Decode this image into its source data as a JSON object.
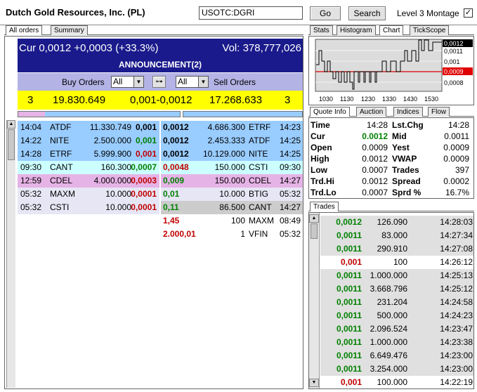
{
  "header": {
    "title": "Dutch Gold Resources, Inc. (PL)",
    "symbol": "USOTC:DGRI",
    "go_label": "Go",
    "search_label": "Search",
    "montage_label": "Level 3 Montage",
    "montage_checked": true
  },
  "left_tabs": [
    "All orders",
    "Summary"
  ],
  "banner": {
    "cur": "Cur 0,0012 +0,0003 (+33.3%)",
    "vol": "Vol: 378,777,026",
    "announcement": "ANNOUNCEMENT(2)",
    "bg": "#1a1a8c"
  },
  "filters": {
    "buy_label": "Buy Orders",
    "buy_value": "All",
    "sell_label": "Sell Orders",
    "sell_value": "All"
  },
  "summary": {
    "buy_count": "3",
    "buy_size": "19.830.649",
    "spread": "0,001-0,0012",
    "sell_size": "17.268.633",
    "sell_count": "3"
  },
  "buy_orders": [
    {
      "time": "14:04",
      "mm": "ATDF",
      "size": "11.330.749",
      "price": "0,001",
      "bg": "#99ccff",
      "color": "#000"
    },
    {
      "time": "14:22",
      "mm": "NITE",
      "size": "2.500.000",
      "price": "0,001",
      "bg": "#99ccff",
      "color": "#008000"
    },
    {
      "time": "14:28",
      "mm": "ETRF",
      "size": "5.999.900",
      "price": "0,001",
      "bg": "#99ccff",
      "color": "#c00000"
    },
    {
      "time": "09:30",
      "mm": "CANT",
      "size": "160.300",
      "price": "0,0007",
      "bg": "#ccffff",
      "color": "#008000"
    },
    {
      "time": "12:59",
      "mm": "CDEL",
      "size": "4.000.000",
      "price": "0,0003",
      "bg": "#e6b3e6",
      "color": "#c00000"
    },
    {
      "time": "05:32",
      "mm": "MAXM",
      "size": "10.000",
      "price": "0,0001",
      "bg": "#e6e6f5",
      "color": "#c00000"
    },
    {
      "time": "05:32",
      "mm": "CSTI",
      "size": "10.000",
      "price": "0,0001",
      "bg": "#e6e6f5",
      "color": "#c00000"
    }
  ],
  "sell_orders": [
    {
      "price": "0,0012",
      "size": "4.686.300",
      "mm": "ETRF",
      "time": "14:23",
      "bg": "#99ccff",
      "color": "#000"
    },
    {
      "price": "0,0012",
      "size": "2.453.333",
      "mm": "ATDF",
      "time": "14:25",
      "bg": "#99ccff",
      "color": "#000"
    },
    {
      "price": "0,0012",
      "size": "10.129.000",
      "mm": "NITE",
      "time": "14:25",
      "bg": "#99ccff",
      "color": "#000"
    },
    {
      "price": "0,0048",
      "size": "150.000",
      "mm": "CSTI",
      "time": "09:30",
      "bg": "#ccffff",
      "color": "#c00000"
    },
    {
      "price": "0,009",
      "size": "150.000",
      "mm": "CDEL",
      "time": "14:27",
      "bg": "#e6b3e6",
      "color": "#008000"
    },
    {
      "price": "0,01",
      "size": "10.000",
      "mm": "BTIG",
      "time": "05:32",
      "bg": "#e6e6f5",
      "color": "#008000"
    },
    {
      "price": "0,11",
      "size": "86.500",
      "mm": "CANT",
      "time": "14:27",
      "bg": "#cccccc",
      "color": "#008000"
    },
    {
      "price": "1,45",
      "size": "100",
      "mm": "MAXM",
      "time": "08:49",
      "bg": "#ffffff",
      "color": "#c00000"
    },
    {
      "price": "2.000,01",
      "size": "1",
      "mm": "VFIN",
      "time": "05:32",
      "bg": "#ffffff",
      "color": "#c00000"
    }
  ],
  "chart_tabs": [
    "Stats",
    "Histogram",
    "Chart",
    "TickScope"
  ],
  "mini_chart": {
    "price_labels": [
      "0,0012",
      "0,0011",
      "0,001",
      "0,0009",
      "0,0008"
    ],
    "time_labels": [
      "1030",
      "1130",
      "1230",
      "1330",
      "1430",
      "1530"
    ],
    "ref_price": 0.0009
  },
  "quote_tabs": [
    "Quote Info",
    "Auction",
    "Indices",
    "Flow"
  ],
  "quote": {
    "rows": [
      {
        "l1": "Time",
        "v1": "14:28",
        "l2": "Lst.Chg",
        "v2": "14:28",
        "c1": "#000"
      },
      {
        "l1": "Cur",
        "v1": "0.0012",
        "l2": "Mid",
        "v2": "0.0011",
        "c1": "#008000"
      },
      {
        "l1": "Open",
        "v1": "0.0009",
        "l2": "Yest",
        "v2": "0.0009",
        "c1": "#000"
      },
      {
        "l1": "High",
        "v1": "0.0012",
        "l2": "VWAP",
        "v2": "0.0009",
        "c1": "#000"
      },
      {
        "l1": "Low",
        "v1": "0.0007",
        "l2": "Trades",
        "v2": "397",
        "c1": "#000"
      },
      {
        "l1": "Trd.Hi",
        "v1": "0.0012",
        "l2": "Spread",
        "v2": "0.0002",
        "c1": "#000"
      },
      {
        "l1": "Trd.Lo",
        "v1": "0.0007",
        "l2": "Sprd %",
        "v2": "16.7%",
        "c1": "#000"
      }
    ]
  },
  "trades_tab": "Trades",
  "trades": [
    {
      "price": "0,0012",
      "size": "126.090",
      "time": "14:28:03",
      "color": "#008000",
      "bg": "#e0e0e0"
    },
    {
      "price": "0,0011",
      "size": "83.000",
      "time": "14:27:34",
      "color": "#008000",
      "bg": "#e0e0e0"
    },
    {
      "price": "0,0011",
      "size": "290.910",
      "time": "14:27:08",
      "color": "#008000",
      "bg": "#e0e0e0"
    },
    {
      "price": "0,001",
      "size": "100",
      "time": "14:26:12",
      "color": "#c00000",
      "bg": "#ffffff"
    },
    {
      "price": "0,0011",
      "size": "1.000.000",
      "time": "14:25:13",
      "color": "#008000",
      "bg": "#e0e0e0"
    },
    {
      "price": "0,0011",
      "size": "3.668.796",
      "time": "14:25:12",
      "color": "#008000",
      "bg": "#e0e0e0"
    },
    {
      "price": "0,0011",
      "size": "231.204",
      "time": "14:24:58",
      "color": "#008000",
      "bg": "#e0e0e0"
    },
    {
      "price": "0,0011",
      "size": "500.000",
      "time": "14:24:23",
      "color": "#008000",
      "bg": "#e0e0e0"
    },
    {
      "price": "0,0011",
      "size": "2.096.524",
      "time": "14:23:47",
      "color": "#008000",
      "bg": "#e0e0e0"
    },
    {
      "price": "0,0011",
      "size": "1.000.000",
      "time": "14:23:38",
      "color": "#008000",
      "bg": "#e0e0e0"
    },
    {
      "price": "0,0011",
      "size": "6.649.476",
      "time": "14:23:00",
      "color": "#008000",
      "bg": "#e0e0e0"
    },
    {
      "price": "0,0011",
      "size": "3.254.000",
      "time": "14:23:00",
      "color": "#008000",
      "bg": "#e0e0e0"
    },
    {
      "price": "0,001",
      "size": "100.000",
      "time": "14:22:19",
      "color": "#c00000",
      "bg": "#ffffff"
    }
  ]
}
